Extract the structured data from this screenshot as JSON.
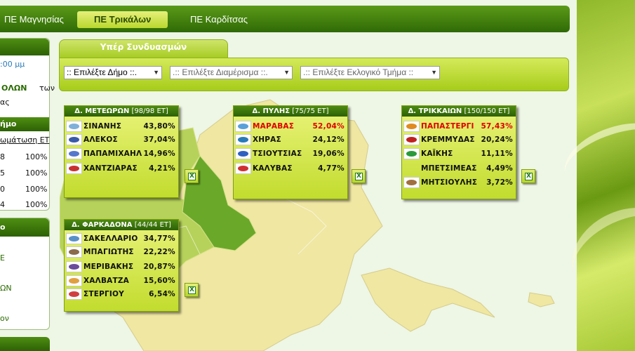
{
  "nav": {
    "tabs": [
      {
        "label": "ΠΕ Μαγνησίας"
      },
      {
        "label": "ΠΕ Τρικάλων"
      },
      {
        "label": "ΠΕ Καρδίτσας"
      }
    ]
  },
  "sidebar": {
    "time": ":00 μμ",
    "line1_bold": "ΟΛΩΝ",
    "line1_rest": "των",
    "line2": "ας",
    "section_title": "ήμο",
    "col_link": "ωμάτωση ΕΤ",
    "rows": [
      {
        "num": "8",
        "pct": "100%"
      },
      {
        "num": "5",
        "pct": "100%"
      },
      {
        "num": "0",
        "pct": "100%"
      },
      {
        "num": "4",
        "pct": "100%"
      }
    ],
    "lower_head": "ο",
    "lower_items": [
      "Ε",
      "ΩΝ",
      "ον"
    ]
  },
  "section_tab": "Υπέρ Συνδυασμών",
  "filters": {
    "municipality": ":: Επιλέξτε Δήμο ::.",
    "district": ".:: Επιλέξτε Διαμέρισμα ::.",
    "precinct": ".:: Επιλέξτε Εκλογικό Τμήμα ::"
  },
  "colors": {
    "winner": "#e00000",
    "header_green": "#2c6005",
    "map_selected": "#6aa82a",
    "map_base": "#efe7a2"
  },
  "results": [
    {
      "municipality": "Δ. ΜΕΤΕΩΡΩΝ",
      "counted": "[98/98 ΕΤ]",
      "candidates": [
        {
          "name": "ΣΙΝΑΝΗΣ",
          "pct": "43,80%",
          "winner": false
        },
        {
          "name": "ΑΛΕΚΟΣ",
          "pct": "37,04%",
          "winner": false
        },
        {
          "name": "ΠΑΠΑΜΙΧΑΗΛ",
          "pct": "14,96%",
          "winner": false
        },
        {
          "name": "ΧΑΝΤΖΙΑΡΑΣ",
          "pct": "4,21%",
          "winner": false
        }
      ]
    },
    {
      "municipality": "Δ. ΠΥΛΗΣ",
      "counted": "[75/75 ΕΤ]",
      "candidates": [
        {
          "name": "ΜΑΡΑΒΑΣ",
          "pct": "52,04%",
          "winner": true
        },
        {
          "name": "ΧΗΡΑΣ",
          "pct": "24,12%",
          "winner": false
        },
        {
          "name": "ΤΣΙΟΥΤΣΙΑΣ",
          "pct": "19,06%",
          "winner": false
        },
        {
          "name": "ΚΑΛΥΒΑΣ",
          "pct": "4,77%",
          "winner": false
        }
      ]
    },
    {
      "municipality": "Δ. ΤΡΙΚΚΑΙΩΝ",
      "counted": "[150/150 ΕΤ]",
      "candidates": [
        {
          "name": "ΠΑΠΑΣΤΕΡΓΙ",
          "pct": "57,43%",
          "winner": true
        },
        {
          "name": "ΚΡΕΜΜΥΔΑΣ",
          "pct": "20,24%",
          "winner": false
        },
        {
          "name": "ΚΑΪΚΗΣ",
          "pct": "11,11%",
          "winner": false
        },
        {
          "name": "ΜΠΕΤΣΙΜΕΑΣ",
          "pct": "4,49%",
          "winner": false
        },
        {
          "name": "ΜΗΤΣΙΟΥΛΗΣ",
          "pct": "3,72%",
          "winner": false
        }
      ]
    },
    {
      "municipality": "Δ. ΦΑΡΚΑΔΟΝΑ",
      "counted": "[44/44 ΕΤ]",
      "candidates": [
        {
          "name": "ΣΑΚΕΛΛΑΡΙΟ",
          "pct": "34,77%",
          "winner": false
        },
        {
          "name": "ΜΠΑΓΙΩΤΗΣ",
          "pct": "22,22%",
          "winner": false
        },
        {
          "name": "ΜΕΡΙΒΑΚΗΣ",
          "pct": "20,87%",
          "winner": false
        },
        {
          "name": "ΧΑΛΒΑΤΖΑ",
          "pct": "15,60%",
          "winner": false
        },
        {
          "name": "ΣΤΕΡΓΙΟΥ",
          "pct": "6,54%",
          "winner": false
        }
      ]
    }
  ],
  "export_icon": "excel-icon"
}
